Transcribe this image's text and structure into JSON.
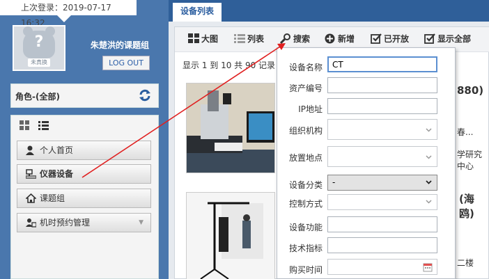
{
  "sidebar": {
    "last_login": "上次登录：2019-07-17 16:32",
    "avatar_badge": "未真换",
    "group_name": "朱楚洪的课题组",
    "logout_label": "LOG OUT",
    "role_label": "角色-(全部)",
    "menu": [
      {
        "label": "个人首页",
        "icon": "user-icon"
      },
      {
        "label": "仪器设备",
        "icon": "computer-icon"
      },
      {
        "label": "课题组",
        "icon": "home-icon"
      },
      {
        "label": "机时预约管理",
        "icon": "schedule-icon"
      }
    ]
  },
  "main": {
    "tab_label": "设备列表",
    "toolbar": {
      "large_view": "大图",
      "list_view": "列表",
      "search": "搜索",
      "add": "新增",
      "opened": "已开放",
      "show_all": "显示全部"
    },
    "record_count": "显示 1 到 10 共 90 记录",
    "row1_fragments": {
      "title_end": "880)",
      "line1": "春...",
      "line2": "学研究中心"
    },
    "row2_fragments": {
      "title_end": "(海鸥)",
      "line1": "二楼"
    }
  },
  "search_form": {
    "fields": [
      {
        "label": "设备名称",
        "value": "CT"
      },
      {
        "label": "资产编号",
        "value": ""
      },
      {
        "label": "IP地址",
        "value": ""
      },
      {
        "label": "组织机构",
        "value": ""
      },
      {
        "label": "放置地点",
        "value": ""
      },
      {
        "label": "设备分类",
        "value": "-"
      },
      {
        "label": "控制方式",
        "value": ""
      },
      {
        "label": "设备功能",
        "value": ""
      },
      {
        "label": "技术指标",
        "value": ""
      },
      {
        "label": "购买时间",
        "value": ""
      }
    ]
  },
  "colors": {
    "sidebar": "#4a77ad",
    "tabbar": "#2f5f99",
    "accent": "#2a5d9f",
    "annotation_arrow": "#e02020"
  }
}
